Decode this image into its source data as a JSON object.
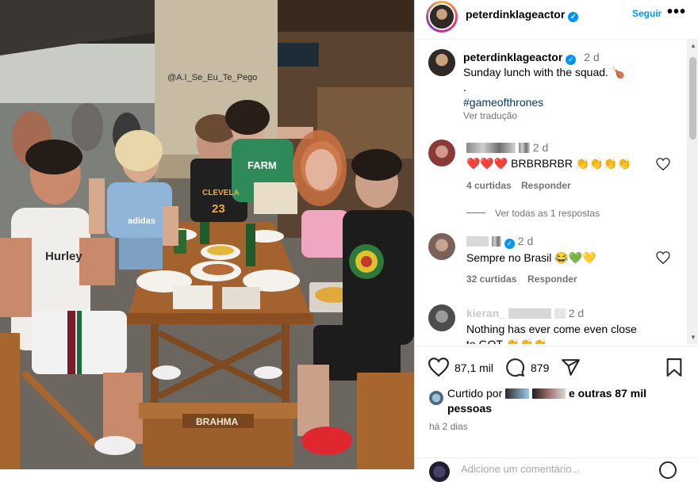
{
  "photo": {
    "watermark": "@A.I_Se_Eu_Te_Pego",
    "sign": "BRAHMA",
    "tank_top_text": "Hurley",
    "shirt_text": "adidas",
    "jersey_text": "CLEVELA",
    "jersey_number": "23",
    "farm_text": "FARM"
  },
  "header": {
    "username": "peterdinklageactor",
    "follow_label": "Seguir",
    "more_label": "•••"
  },
  "caption": {
    "username": "peterdinklageactor",
    "time": "2 d",
    "text": "Sunday lunch with the squad. 🍗",
    "dot": ".",
    "hashtag": "#gameofthrones",
    "translate": "Ver tradução"
  },
  "comments": [
    {
      "time": "2 d",
      "text": "❤️❤️❤️ BRBRBRBR 👏👏👏👏",
      "likes": "4 curtidas",
      "reply": "Responder",
      "view_replies": "Ver todas as 1 respostas"
    },
    {
      "time": "2 d",
      "text": "Sempre no Brasil 😂💚💛",
      "likes": "32 curtidas",
      "reply": "Responder"
    },
    {
      "name_partial": "kieran_",
      "time": "2 d",
      "text": "Nothing has ever come even close",
      "text2": "to GOT 👏👏👏"
    }
  ],
  "actions": {
    "likes_count": "87,1 mil",
    "comments_count": "879",
    "liked_by_prefix": "Curtido por",
    "liked_by_suffix": "e outras 87 mil",
    "liked_by_suffix2": "pessoas",
    "time_ago": "há 2 dias",
    "bottom_partial": "Adicione um comentário..."
  },
  "colors": {
    "accent": "#0095f6",
    "hashtag": "#00376b",
    "muted": "#737373"
  }
}
